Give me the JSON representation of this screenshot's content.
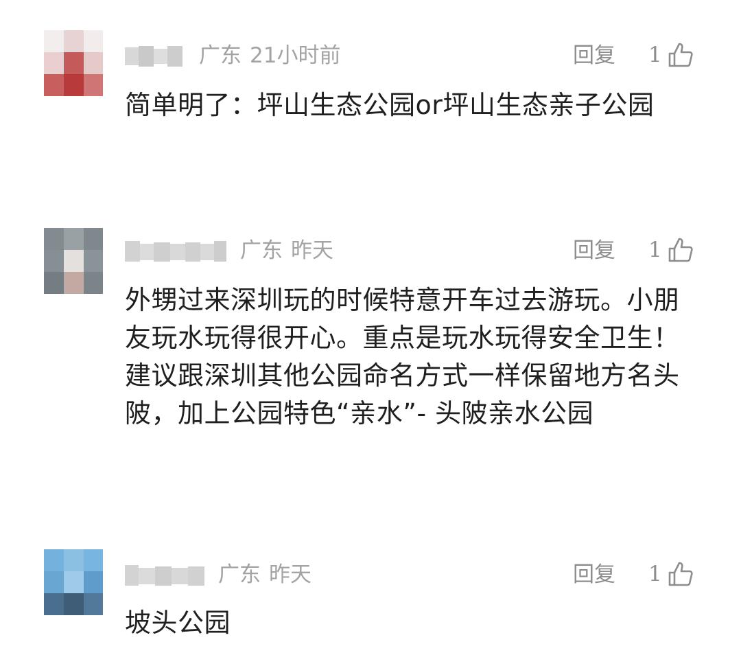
{
  "comments": [
    {
      "region": "广东",
      "time": "21小时前",
      "reply_label": "回复",
      "like_count": "1",
      "text": "简单明了：坪山生态公园or坪山生态亲子公园"
    },
    {
      "region": "广东",
      "time": "昨天",
      "reply_label": "回复",
      "like_count": "1",
      "text": "外甥过来深圳玩的时候特意开车过去游玩。小朋友玩水玩得很开心。重点是玩水玩得安全卫生！建议跟深圳其他公园命名方式一样保留地方名头陂，加上公园特色“亲水”- 头陂亲水公园"
    },
    {
      "region": "广东",
      "time": "昨天",
      "reply_label": "回复",
      "like_count": "1",
      "text": "坡头公园"
    }
  ],
  "icons": {
    "like": "thumbs-up-icon"
  },
  "colors": {
    "text_primary": "#1f1f1f",
    "text_secondary": "#a3a3a3",
    "action_gray": "#8d8d8d",
    "background": "#ffffff"
  }
}
